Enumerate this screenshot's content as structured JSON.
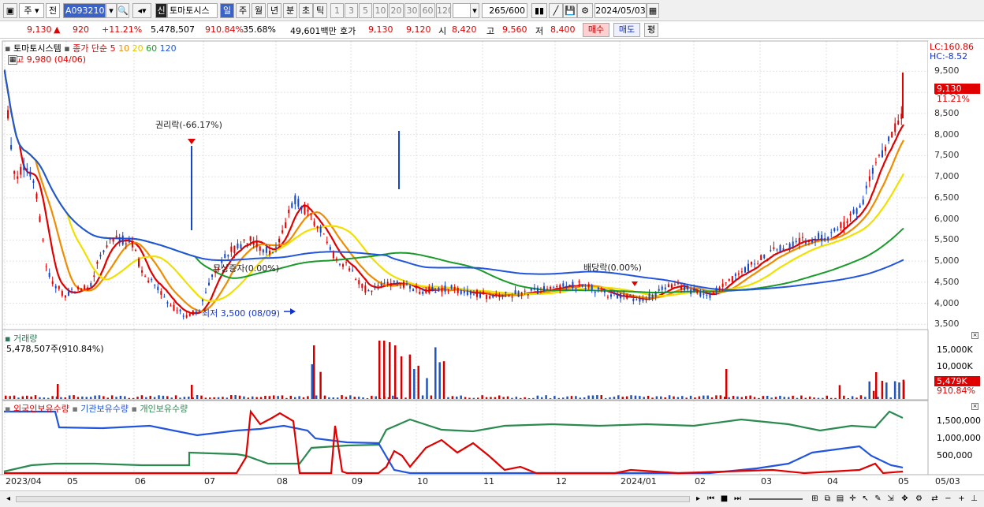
{
  "toolbar": {
    "market_label": "주",
    "market_type": "전",
    "code_value": "A093210",
    "new_badge": "신",
    "stock_name": "토마토시스",
    "periods": [
      "일",
      "주",
      "월",
      "년",
      "분",
      "초",
      "틱"
    ],
    "intervals": [
      "1",
      "3",
      "5",
      "10",
      "20",
      "30",
      "60",
      "120"
    ],
    "count_value": "265",
    "count_total": "/600",
    "date_value": "2024/05/03"
  },
  "infobar": {
    "price": "9,130",
    "change": "920",
    "change_pct": "+11.21%",
    "volume": "5,478,507",
    "volume_ratio": "910.84%",
    "turnover": "35.68%",
    "amount": "49,601백만",
    "bid_label": "호가",
    "ask_price": "9,130",
    "bid_price": "9,120",
    "open_label": "시",
    "open": "8,420",
    "high_label": "고",
    "high": "9,560",
    "low_label": "저",
    "low": "8,400",
    "buy_button": "매수",
    "sell_button": "매도",
    "eval_button": "평"
  },
  "price_pane": {
    "stock_label": "토마토시스템",
    "ma_label": "종가 단순",
    "ma_periods": [
      "5",
      "10",
      "20",
      "60",
      "120"
    ],
    "ma_colors": [
      "#e00000",
      "#f08c00",
      "#f0e000",
      "#1a9a2a",
      "#2255dd"
    ],
    "high_annotation": "최고 9,980 (04/06)",
    "low_annotation": "최저 3,500 (08/09)",
    "rights_annotation": "권리락(-66.17%)",
    "bonus_annotation": "무상증자(0.00%)",
    "dividend_annotation": "배당락(0.00%)",
    "lc": "LC:160.86",
    "hc": "HC:-8.52",
    "price_tag": "9,130",
    "pct_tag": "11.21%",
    "y_ticks": [
      "9,500",
      "9,000",
      "8,500",
      "8,000",
      "7,500",
      "7,000",
      "6,500",
      "6,000",
      "5,500",
      "5,000",
      "4,500",
      "4,000",
      "3,500"
    ]
  },
  "volume_pane": {
    "title": "거래량",
    "value": "5,478,507주(910.84%)",
    "y_ticks": [
      "15,000K",
      "10,000K"
    ],
    "tag_value": "5,479K",
    "tag_pct": "910.84%"
  },
  "holdings_pane": {
    "series": [
      "외국인보유수량",
      "기관보유수량",
      "개인보유수량"
    ],
    "series_colors": [
      "#e00000",
      "#2255dd",
      "#2a8a50"
    ],
    "y_ticks": [
      "1,500,000",
      "1,000,000",
      "500,000"
    ]
  },
  "x_axis": [
    "2023/04",
    "05",
    "06",
    "07",
    "08",
    "09",
    "10",
    "11",
    "12",
    "2024/01",
    "02",
    "03",
    "04",
    "05",
    "05/03"
  ],
  "chart_data": {
    "type": "candlestick",
    "ylim": [
      3300,
      9900
    ],
    "ma_periods": [
      5,
      10,
      20,
      60,
      120
    ],
    "key_points": [
      {
        "date": "04/06",
        "label": "최고",
        "value": 9980
      },
      {
        "date": "08/09",
        "label": "최저",
        "value": 3500
      }
    ],
    "last": {
      "date": "2024/05/03",
      "open": 8420,
      "high": 9560,
      "low": 8400,
      "close": 9130,
      "volume": 5478507
    }
  }
}
